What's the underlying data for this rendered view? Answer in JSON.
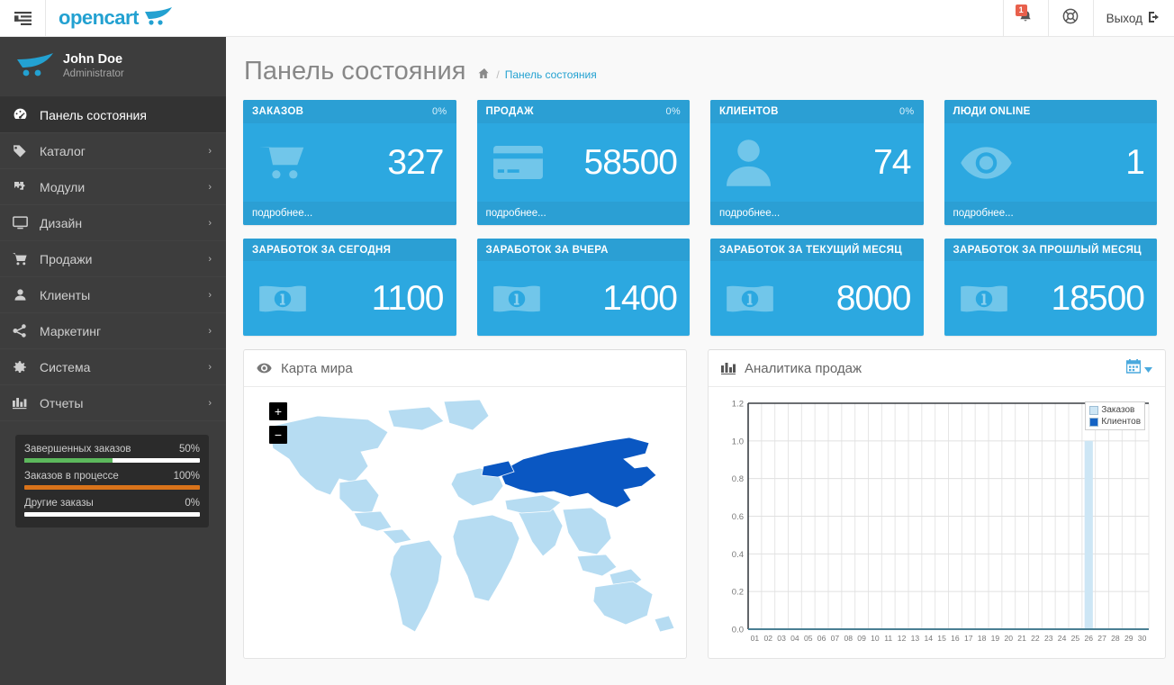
{
  "topbar": {
    "hamburger_icon": "menu-collapse-icon",
    "brand_text": "opencart",
    "brand_cart_icon": "cart-logo-icon",
    "notification_icon": "bell-icon",
    "notification_count": "1",
    "support_icon": "lifebuoy-icon",
    "logout_label": "Выход",
    "logout_icon": "logout-icon"
  },
  "sidebar": {
    "profile": {
      "name": "John Doe",
      "role": "Administrator",
      "logo_icon": "cart-logo-icon"
    },
    "items": [
      {
        "label": "Панель состояния",
        "icon": "dashboard-icon",
        "caret": "",
        "active": true
      },
      {
        "label": "Каталог",
        "icon": "tag-icon",
        "caret": "›",
        "active": false
      },
      {
        "label": "Модули",
        "icon": "puzzle-icon",
        "caret": "›",
        "active": false
      },
      {
        "label": "Дизайн",
        "icon": "monitor-icon",
        "caret": "›",
        "active": false
      },
      {
        "label": "Продажи",
        "icon": "cart-icon",
        "caret": "›",
        "active": false
      },
      {
        "label": "Клиенты",
        "icon": "user-icon",
        "caret": "›",
        "active": false
      },
      {
        "label": "Маркетинг",
        "icon": "share-icon",
        "caret": "›",
        "active": false
      },
      {
        "label": "Система",
        "icon": "gear-icon",
        "caret": "›",
        "active": false
      },
      {
        "label": "Отчеты",
        "icon": "bar-chart-icon",
        "caret": "›",
        "active": false
      }
    ],
    "progress": [
      {
        "label": "Завершенных заказов",
        "value": "50%",
        "pct": 50,
        "color": "#5cb85c"
      },
      {
        "label": "Заказов в процессе",
        "value": "100%",
        "pct": 100,
        "color": "#d9731a"
      },
      {
        "label": "Другие заказы",
        "value": "0%",
        "pct": 0,
        "color": "#5bc0de"
      }
    ]
  },
  "page": {
    "title": "Панель состояния",
    "breadcrumb_home_icon": "home-icon",
    "breadcrumb_separator": "/",
    "breadcrumb_current": "Панель состояния"
  },
  "tiles_row1": [
    {
      "title": "ЗАКАЗОВ",
      "pct": "0%",
      "value": "327",
      "icon": "shopping-cart-icon",
      "footer": "подробнее..."
    },
    {
      "title": "ПРОДАЖ",
      "pct": "0%",
      "value": "58500",
      "icon": "credit-card-icon",
      "footer": "подробнее..."
    },
    {
      "title": "КЛИЕНТОВ",
      "pct": "0%",
      "value": "74",
      "icon": "person-icon",
      "footer": "подробнее..."
    },
    {
      "title": "ЛЮДИ ONLINE",
      "pct": "",
      "value": "1",
      "icon": "eye-icon",
      "footer": "подробнее..."
    }
  ],
  "tiles_row2": [
    {
      "title": "ЗАРАБОТОК ЗА СЕГОДНЯ",
      "value": "1100",
      "icon": "money-icon"
    },
    {
      "title": "ЗАРАБОТОК ЗА ВЧЕРА",
      "value": "1400",
      "icon": "money-icon"
    },
    {
      "title": "ЗАРАБОТОК ЗА ТЕКУЩИЙ МЕСЯЦ",
      "value": "8000",
      "icon": "money-icon"
    },
    {
      "title": "ЗАРАБОТОК ЗА ПРОШЛЫЙ МЕСЯЦ",
      "value": "18500",
      "icon": "money-icon"
    }
  ],
  "map_panel": {
    "title": "Карта мира",
    "icon": "eye-icon",
    "zoom_in_label": "+",
    "zoom_out_label": "−",
    "highlight_country": "Россия",
    "highlight_color": "#0a57c2",
    "base_color": "#b6dcf2"
  },
  "chart_panel": {
    "title": "Аналитика продаж",
    "icon": "bar-chart-icon",
    "calendar_icon": "calendar-icon",
    "caret_icon": "chevron-down-icon"
  },
  "chart_data": {
    "type": "bar",
    "title": "Аналитика продаж",
    "xlabel": "",
    "ylabel": "",
    "grid": true,
    "legend_position": "top-right",
    "ylim": [
      0,
      1.2
    ],
    "yticks": [
      "0.0",
      "0.2",
      "0.4",
      "0.6",
      "0.8",
      "1.0",
      "1.2"
    ],
    "categories": [
      "01",
      "02",
      "03",
      "04",
      "05",
      "06",
      "07",
      "08",
      "09",
      "10",
      "11",
      "12",
      "13",
      "14",
      "15",
      "16",
      "17",
      "18",
      "19",
      "20",
      "21",
      "22",
      "23",
      "24",
      "25",
      "26",
      "27",
      "28",
      "29",
      "30"
    ],
    "series": [
      {
        "name": "Заказов",
        "color": "#cde6f5",
        "values": [
          0,
          0,
          0,
          0,
          0,
          0,
          0,
          0,
          0,
          0,
          0,
          0,
          0,
          0,
          0,
          0,
          0,
          0,
          0,
          0,
          0,
          0,
          0,
          0,
          0,
          1.0,
          0,
          0,
          0,
          0
        ]
      },
      {
        "name": "Клиентов",
        "color": "#1563c4",
        "values": [
          0,
          0,
          0,
          0,
          0,
          0,
          0,
          0,
          0,
          0,
          0,
          0,
          0,
          0,
          0,
          0,
          0,
          0,
          0,
          0,
          0,
          0,
          0,
          0,
          0,
          0,
          0,
          0,
          0,
          0
        ]
      }
    ]
  },
  "colors": {
    "accent": "#23a1d1",
    "tile_bg": "#2ca8e0",
    "tile_head": "#2b9fd4",
    "sidebar_bg": "#3d3d3d"
  }
}
